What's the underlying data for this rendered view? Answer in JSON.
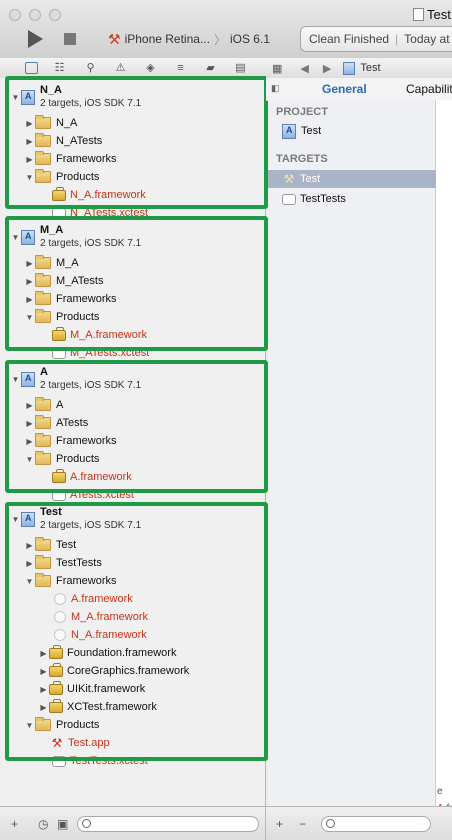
{
  "window": {
    "title": "Test"
  },
  "toolbar": {
    "run_icon": "play-icon",
    "stop_icon": "stop-icon",
    "scheme_device": "iPhone Retina...",
    "scheme_sep": "〉",
    "scheme_sdk": "iOS 6.1",
    "status_text": "Clean Finished",
    "status_time": "Today at"
  },
  "navigator": {
    "groups": [
      {
        "project": "N_A",
        "subtitle": "2 targets, iOS SDK 7.1",
        "items": [
          {
            "label": "N_A",
            "kind": "folder"
          },
          {
            "label": "N_ATests",
            "kind": "folder"
          },
          {
            "label": "Frameworks",
            "kind": "folder"
          },
          {
            "label": "Products",
            "kind": "folder",
            "open": true
          },
          {
            "label": "N_A.framework",
            "kind": "product"
          },
          {
            "label": "N_ATests.xctest",
            "kind": "xctest"
          }
        ]
      },
      {
        "project": "M_A",
        "subtitle": "2 targets, iOS SDK 7.1",
        "items": [
          {
            "label": "M_A",
            "kind": "folder"
          },
          {
            "label": "M_ATests",
            "kind": "folder"
          },
          {
            "label": "Frameworks",
            "kind": "folder"
          },
          {
            "label": "Products",
            "kind": "folder",
            "open": true
          },
          {
            "label": "M_A.framework",
            "kind": "product"
          },
          {
            "label": "M_ATests.xctest",
            "kind": "xctest"
          }
        ]
      },
      {
        "project": "A",
        "subtitle": "2 targets, iOS SDK 7.1",
        "items": [
          {
            "label": "A",
            "kind": "folder"
          },
          {
            "label": "ATests",
            "kind": "folder"
          },
          {
            "label": "Frameworks",
            "kind": "folder"
          },
          {
            "label": "Products",
            "kind": "folder",
            "open": true
          },
          {
            "label": "A.framework",
            "kind": "product"
          },
          {
            "label": "ATests.xctest",
            "kind": "xctest"
          }
        ]
      },
      {
        "project": "Test",
        "subtitle": "2 targets, iOS SDK 7.1",
        "items": [
          {
            "label": "Test",
            "kind": "folder"
          },
          {
            "label": "TestTests",
            "kind": "folder"
          },
          {
            "label": "Frameworks",
            "kind": "folder",
            "open": true
          },
          {
            "label": "A.framework",
            "kind": "missing"
          },
          {
            "label": "M_A.framework",
            "kind": "missing"
          },
          {
            "label": "N_A.framework",
            "kind": "missing"
          },
          {
            "label": "Foundation.framework",
            "kind": "sysfw"
          },
          {
            "label": "CoreGraphics.framework",
            "kind": "sysfw"
          },
          {
            "label": "UIKit.framework",
            "kind": "sysfw"
          },
          {
            "label": "XCTest.framework",
            "kind": "sysfw"
          },
          {
            "label": "Products",
            "kind": "folder",
            "open": true
          },
          {
            "label": "Test.app",
            "kind": "app"
          },
          {
            "label": "TestTests.xctest",
            "kind": "xctest"
          }
        ]
      }
    ]
  },
  "editor": {
    "breadcrumb": "Test",
    "tabs": [
      "General",
      "Capabilit"
    ],
    "project_header": "PROJECT",
    "project_item": "Test",
    "targets_header": "TARGETS",
    "targets": [
      "Test",
      "TestTests"
    ],
    "edge_texts": [
      "e",
      "A.fr"
    ]
  },
  "colors": {
    "highlight": "#1f9a46",
    "error_red": "#c8331a",
    "accent": "#2a6bbf"
  }
}
